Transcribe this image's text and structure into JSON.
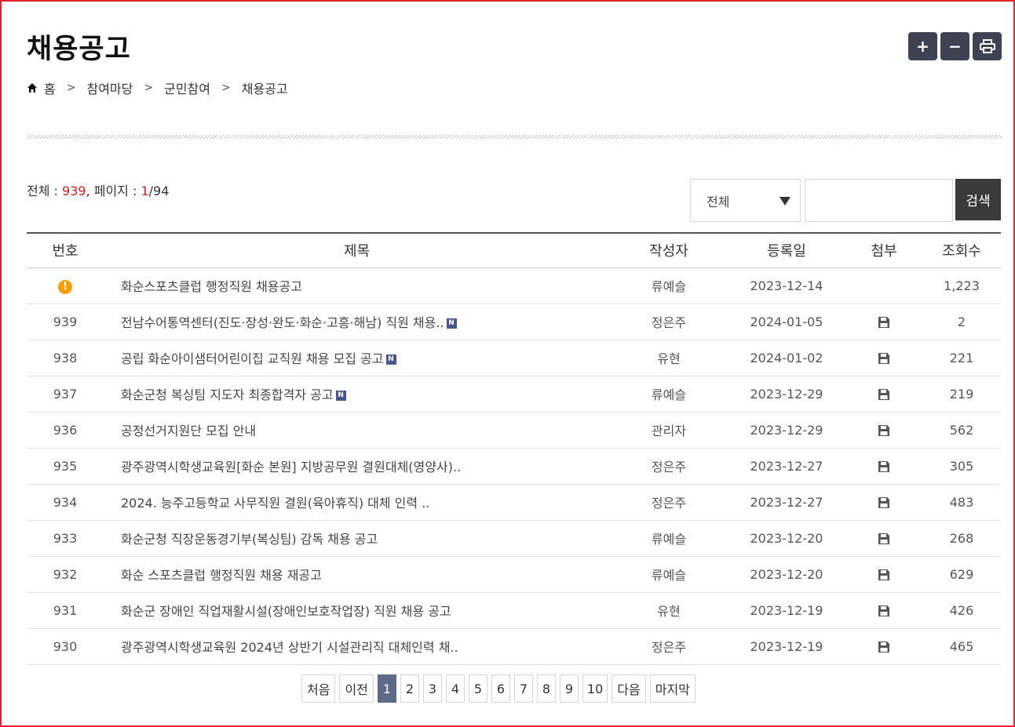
{
  "page": {
    "title": "채용공고"
  },
  "tools": {
    "zoom_in": "+",
    "zoom_out": "−"
  },
  "breadcrumb": {
    "home": "홈",
    "level1": "참여마당",
    "level2": "군민참여",
    "current": "채용공고"
  },
  "summary": {
    "total_label": "전체 : ",
    "total": "939",
    "page_label": ", 페이지 : ",
    "page_current": "1",
    "page_total": "/94"
  },
  "search": {
    "select_value": "전체",
    "button_label": "검색",
    "input_value": ""
  },
  "table": {
    "headers": [
      "번호",
      "제목",
      "작성자",
      "등록일",
      "첨부",
      "조회수"
    ],
    "rows": [
      {
        "num": "",
        "notice": true,
        "title": "화순스포츠클럽 행정직원 채용공고",
        "new": false,
        "author": "류예슬",
        "date": "2023-12-14",
        "attach": false,
        "views": "1,223"
      },
      {
        "num": "939",
        "notice": false,
        "title": "전남수어통역센터(진도·장성·완도·화순·고흥·해남) 직원 채용..",
        "new": true,
        "author": "정은주",
        "date": "2024-01-05",
        "attach": true,
        "views": "2"
      },
      {
        "num": "938",
        "notice": false,
        "title": "공립 화순아이샘터어린이집 교직원 채용 모집 공고",
        "new": true,
        "author": "유현",
        "date": "2024-01-02",
        "attach": true,
        "views": "221"
      },
      {
        "num": "937",
        "notice": false,
        "title": "화순군청 복싱팀 지도자 최종합격자 공고",
        "new": true,
        "author": "류예슬",
        "date": "2023-12-29",
        "attach": true,
        "views": "219"
      },
      {
        "num": "936",
        "notice": false,
        "title": "공정선거지원단 모집 안내",
        "new": false,
        "author": "관리자",
        "date": "2023-12-29",
        "attach": true,
        "views": "562"
      },
      {
        "num": "935",
        "notice": false,
        "title": "광주광역시학생교육원[화순 본원] 지방공무원 결원대체(영양사)..",
        "new": false,
        "author": "정은주",
        "date": "2023-12-27",
        "attach": true,
        "views": "305"
      },
      {
        "num": "934",
        "notice": false,
        "title": "2024. 능주고등학교 사무직원 결원(육아휴직) 대체 인력 ..",
        "new": false,
        "author": "정은주",
        "date": "2023-12-27",
        "attach": true,
        "views": "483"
      },
      {
        "num": "933",
        "notice": false,
        "title": "화순군청 직장운동경기부(복싱팀) 감독 채용 공고",
        "new": false,
        "author": "류예슬",
        "date": "2023-12-20",
        "attach": true,
        "views": "268"
      },
      {
        "num": "932",
        "notice": false,
        "title": "화순 스포츠클럽 행정직원 채용 재공고",
        "new": false,
        "author": "류예슬",
        "date": "2023-12-20",
        "attach": true,
        "views": "629"
      },
      {
        "num": "931",
        "notice": false,
        "title": "화순군 장애인 직업재활시설(장애인보호작업장) 직원 채용 공고",
        "new": false,
        "author": "유현",
        "date": "2023-12-19",
        "attach": true,
        "views": "426"
      },
      {
        "num": "930",
        "notice": false,
        "title": "광주광역시학생교육원 2024년 상반기 시설관리직 대체인력 채..",
        "new": false,
        "author": "정은주",
        "date": "2023-12-19",
        "attach": true,
        "views": "465"
      }
    ]
  },
  "pagination": {
    "first": "처음",
    "prev": "이전",
    "pages": [
      "1",
      "2",
      "3",
      "4",
      "5",
      "6",
      "7",
      "8",
      "9",
      "10"
    ],
    "current": "1",
    "next": "다음",
    "last": "마지막"
  },
  "icons": {
    "notice": "!",
    "new_badge": "N"
  },
  "colors": {
    "accent_red": "#d42020",
    "tool_bg": "#3d4352",
    "active_page": "#5d6a8a",
    "notice_orange": "#f5a00a"
  }
}
